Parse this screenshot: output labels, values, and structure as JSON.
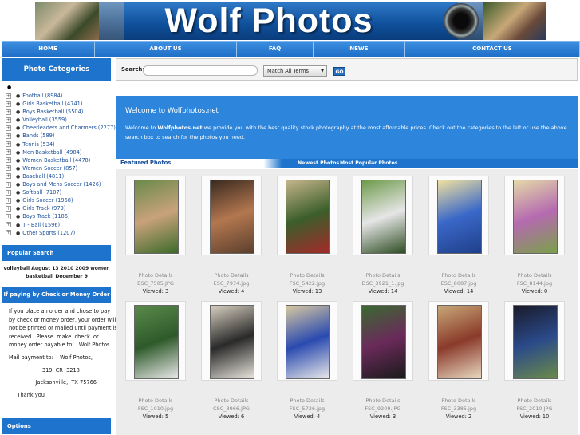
{
  "banner": {
    "title": "Wolf Photos"
  },
  "nav": [
    {
      "label": "HOME",
      "width": 117
    },
    {
      "label": "ABOUT US",
      "width": 178
    },
    {
      "label": "FAQ",
      "width": 96
    },
    {
      "label": "NEWS",
      "width": 115
    },
    {
      "label": "CONTACT US",
      "width": 219
    }
  ],
  "sidebar": {
    "categories_title": "Photo Categories",
    "categories": [
      {
        "label": "Football (8984)"
      },
      {
        "label": "Girls Basketball (4741)"
      },
      {
        "label": "Boys Basketball (5504)"
      },
      {
        "label": "Volleyball (3559)"
      },
      {
        "label": "Cheerleaders and Charmers (2277)"
      },
      {
        "label": "Bands (589)"
      },
      {
        "label": "Tennis (534)"
      },
      {
        "label": "Men Basketball (4984)"
      },
      {
        "label": "Women Basketball (4478)"
      },
      {
        "label": "Women Soccer (857)"
      },
      {
        "label": "Baseball (4811)"
      },
      {
        "label": "Boys and Mens Soccer (1426)"
      },
      {
        "label": "Softball (7107)"
      },
      {
        "label": "Girls Soccer (1968)"
      },
      {
        "label": "Girls Track (979)"
      },
      {
        "label": "Boys Track (1186)"
      },
      {
        "label": "T - Ball (1596)"
      },
      {
        "label": "Other Sports (1207)"
      }
    ],
    "popular_title": "Popular Search",
    "popular_text": "volleyball August 13 2010 2009 women basketball December 9",
    "pay_title": "If paying by Check or Money Order",
    "pay_lines": [
      "If you place an order and chose to pay",
      "by check or money order, your order will",
      "not be printed or mailed until payment is",
      "received.  Please  make  check  or",
      "money order payable to:   Wolf Photos",
      "",
      "Mail payment to:    Wolf Photos,",
      "",
      "                    319  CR  3218",
      "",
      "                Jacksonville,  TX 75766",
      "",
      "     Thank you"
    ],
    "options_title": "Options"
  },
  "search": {
    "label": "Search:",
    "value": "",
    "match_option": "Match All Terms",
    "go_label": "GO"
  },
  "welcome": {
    "title": "Welcome to Wolfphotos.net",
    "text_prefix": "Welcome to ",
    "site": "Wolfphotos.net",
    "text_rest": " we provide you with the best quality stock photography at the most affordable prices. Check out the categories to the left or use the above search box to search for the photos you need."
  },
  "tabs": {
    "featured": "Featured Photos",
    "newest": "Newest Photos",
    "popular": "Most Popular Photos"
  },
  "photos": [
    {
      "details": "Photo Details",
      "file": "BSC_7505.JPG",
      "viewed": "Viewed: 3",
      "colors": [
        "#6a8a4a",
        "#c9a27a",
        "#3d6b2a"
      ]
    },
    {
      "details": "Photo Details",
      "file": "ESC_7974.jpg",
      "viewed": "Viewed: 4",
      "colors": [
        "#3a2a20",
        "#b3774f",
        "#5b3f2d"
      ]
    },
    {
      "details": "Photo Details",
      "file": "FSC_5422.jpg",
      "viewed": "Viewed: 13",
      "colors": [
        "#c4b48a",
        "#3b5e2a",
        "#a42a2a"
      ]
    },
    {
      "details": "Photo Details",
      "file": "DSC_3921_1.jpg",
      "viewed": "Viewed: 14",
      "colors": [
        "#6e9a4c",
        "#e6e6e6",
        "#2e4d24"
      ]
    },
    {
      "details": "Photo Details",
      "file": "ESC_8087.jpg",
      "viewed": "Viewed: 14",
      "colors": [
        "#efe0a0",
        "#3a68c8",
        "#1f3f8a"
      ]
    },
    {
      "details": "Photo Details",
      "file": "FSC_8144.jpg",
      "viewed": "Viewed: 0",
      "colors": [
        "#e4d9a8",
        "#b56ab0",
        "#7aa04a"
      ]
    },
    {
      "details": "Photo Details",
      "file": "FSC_1010.jpg",
      "viewed": "Viewed: 5",
      "colors": [
        "#5a8a4a",
        "#2e5a2a",
        "#e8e8e8"
      ]
    },
    {
      "details": "Photo Details",
      "file": "CSC_3966.JPG",
      "viewed": "Viewed: 6",
      "colors": [
        "#d8d0c0",
        "#2a2a2a",
        "#e8e4dc"
      ]
    },
    {
      "details": "Photo Details",
      "file": "FSC_5736.jpg",
      "viewed": "Viewed: 4",
      "colors": [
        "#d8c8a0",
        "#2a4ab0",
        "#e8e8e8"
      ]
    },
    {
      "details": "Photo Details",
      "file": "FSC_9209.JPG",
      "viewed": "Viewed: 3",
      "colors": [
        "#3a6a30",
        "#6a2a5a",
        "#1a1a1a"
      ]
    },
    {
      "details": "Photo Details",
      "file": "FSC_3385.jpg",
      "viewed": "Viewed: 2",
      "colors": [
        "#c8a878",
        "#8a3a2a",
        "#e8d8c0"
      ]
    },
    {
      "details": "Photo Details",
      "file": "FSC_2010.JPG",
      "viewed": "Viewed: 10",
      "colors": [
        "#1a1a2a",
        "#2a4a8a",
        "#6a8a4a"
      ]
    }
  ]
}
